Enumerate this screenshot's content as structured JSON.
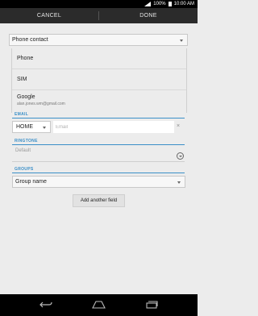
{
  "status_bar": {
    "battery": "100%",
    "time": "10:00 AM"
  },
  "action_bar": {
    "cancel_label": "CANCEL",
    "done_label": "DONE"
  },
  "account": {
    "selected": "Phone contact",
    "options": [
      {
        "label": "Phone"
      },
      {
        "label": "SIM"
      },
      {
        "label": "Google",
        "sub": "alan.jones.wm@gmail.com"
      }
    ]
  },
  "email": {
    "section_label": "EMAIL",
    "type": "HOME",
    "value": "",
    "placeholder": "Email",
    "remove_label": "×"
  },
  "ringtone": {
    "section_label": "RINGTONE",
    "value": "Default"
  },
  "groups": {
    "section_label": "GROUPS",
    "value": "Group name"
  },
  "add_field_label": "Add another field",
  "colors": {
    "accent": "#3a8fc8",
    "action_bar": "#2b2b2b",
    "background": "#ececec"
  },
  "nav_icons": [
    "back-icon",
    "home-icon",
    "recent-apps-icon"
  ]
}
